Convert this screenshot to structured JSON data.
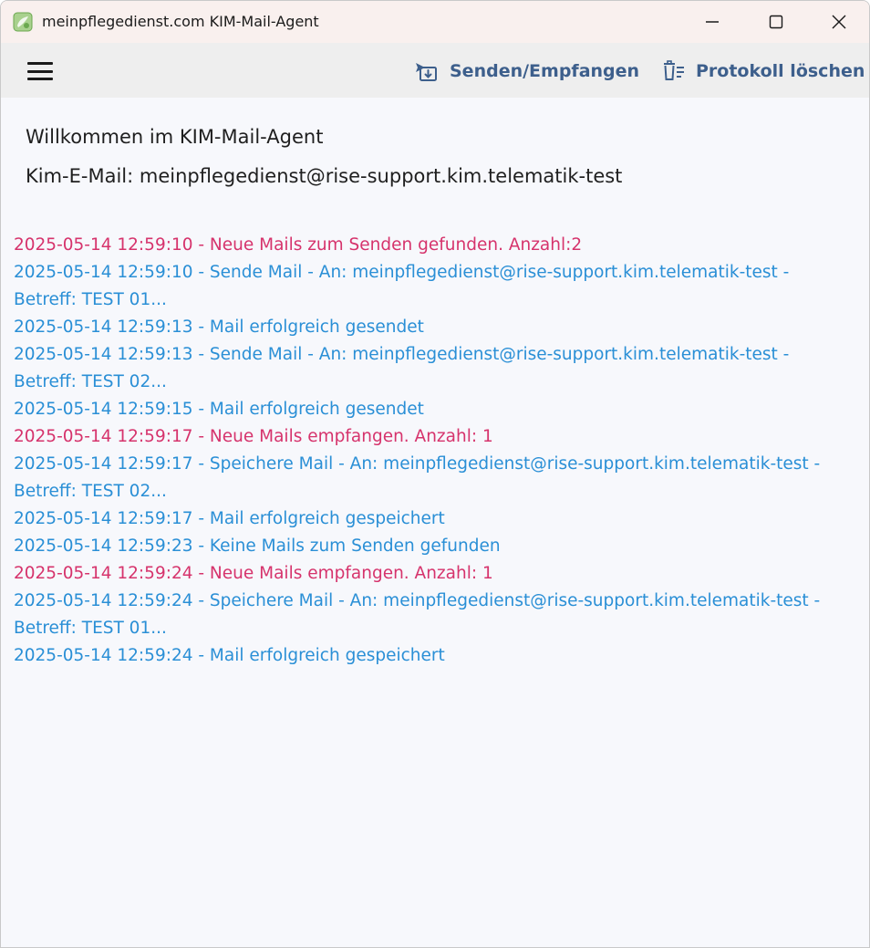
{
  "window": {
    "title": "meinpflegedienst.com KIM-Mail-Agent"
  },
  "toolbar": {
    "send_receive_label": "Senden/Empfangen",
    "clear_log_label": "Protokoll löschen"
  },
  "main": {
    "welcome": "Willkommen im KIM-Mail-Agent",
    "kim_email": "Kim-E-Mail: meinpflegedienst@rise-support.kim.telematik-test"
  },
  "log": [
    {
      "type": "alert",
      "text": "2025-05-14 12:59:10 - Neue Mails zum Senden gefunden. Anzahl:2"
    },
    {
      "type": "info",
      "text": "2025-05-14 12:59:10 - Sende Mail - An: meinpflegedienst@rise-support.kim.telematik-test - Betreff: TEST 01..."
    },
    {
      "type": "info",
      "text": "2025-05-14 12:59:13 - Mail erfolgreich gesendet"
    },
    {
      "type": "info",
      "text": "2025-05-14 12:59:13 - Sende Mail - An: meinpflegedienst@rise-support.kim.telematik-test - Betreff: TEST 02..."
    },
    {
      "type": "info",
      "text": "2025-05-14 12:59:15 - Mail erfolgreich gesendet"
    },
    {
      "type": "alert",
      "text": "2025-05-14 12:59:17 - Neue Mails empfangen. Anzahl: 1"
    },
    {
      "type": "info",
      "text": "2025-05-14 12:59:17 - Speichere  Mail - An: meinpflegedienst@rise-support.kim.telematik-test - Betreff: TEST 02..."
    },
    {
      "type": "info",
      "text": "2025-05-14 12:59:17 - Mail erfolgreich gespeichert"
    },
    {
      "type": "info",
      "text": "2025-05-14 12:59:23 - Keine Mails zum Senden gefunden"
    },
    {
      "type": "alert",
      "text": "2025-05-14 12:59:24 - Neue Mails empfangen. Anzahl: 1"
    },
    {
      "type": "info",
      "text": "2025-05-14 12:59:24 - Speichere  Mail - An: meinpflegedienst@rise-support.kim.telematik-test - Betreff: TEST 01..."
    },
    {
      "type": "info",
      "text": "2025-05-14 12:59:24 - Mail erfolgreich gespeichert"
    }
  ],
  "colors": {
    "info": "#2a8fd6",
    "alert": "#d6336c",
    "toolbar_accent": "#3d5f8c",
    "titlebar_bg": "#f9f0ee"
  },
  "icons": {
    "app": "app-logo-icon",
    "minimize": "minimize-icon",
    "maximize": "maximize-icon",
    "close": "close-icon",
    "menu": "hamburger-menu-icon",
    "send_receive": "send-receive-icon",
    "clear_log": "delete-log-icon"
  }
}
